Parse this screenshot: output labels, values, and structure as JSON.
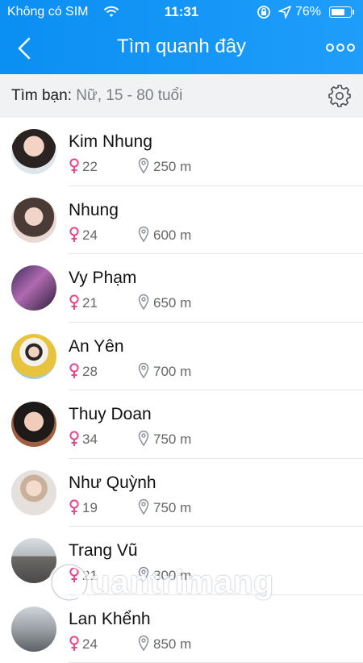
{
  "status_bar": {
    "carrier": "Không có SIM",
    "time": "11:31",
    "battery_pct": "76%",
    "battery_level": 0.76
  },
  "header": {
    "title": "Tìm quanh đây",
    "back_icon": "chevron-left-icon",
    "more_icon": "more-dots-icon"
  },
  "filter": {
    "label": "Tìm bạn:",
    "value": "Nữ, 15 - 80 tuổi",
    "settings_icon": "gear-icon"
  },
  "people": [
    {
      "name": "Kim Nhung",
      "age": "22",
      "distance": "250 m"
    },
    {
      "name": "Nhung",
      "age": "24",
      "distance": "600 m"
    },
    {
      "name": "Vy Phạm",
      "age": "21",
      "distance": "650 m"
    },
    {
      "name": "An Yên",
      "age": "28",
      "distance": "700 m"
    },
    {
      "name": "Thuy Doan",
      "age": "34",
      "distance": "750 m"
    },
    {
      "name": "Như Quỳnh",
      "age": "19",
      "distance": "750 m"
    },
    {
      "name": "Trang Vũ",
      "age": "21",
      "distance": "800 m"
    },
    {
      "name": "Lan Khểnh",
      "age": "24",
      "distance": "850 m"
    }
  ],
  "colors": {
    "accent": "#1a98f7",
    "female": "#e8478e",
    "muted": "#7a7f85"
  },
  "watermark": "uantrimang"
}
